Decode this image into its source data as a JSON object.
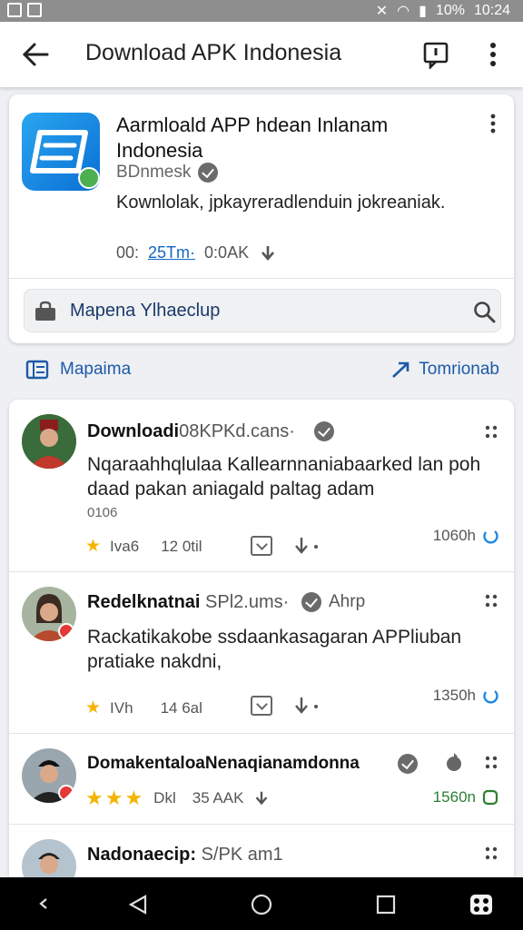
{
  "status": {
    "battery": "10%",
    "time": "10:24"
  },
  "appbar": {
    "title": "Download APK Indonesia"
  },
  "header": {
    "app_title": "Aarmloald APP hdean Inlanam Indonesia",
    "developer": "BDnmesk",
    "description": "Kownlolak, jpkayreradlenduin jokreaniak.",
    "meta_prefix": "00:",
    "meta_link": "25Tm·",
    "meta_size": "0:0AK",
    "search_text": "Mapena Ylhaeclup"
  },
  "section": {
    "left_label": "Mapaima",
    "right_label": "Tomrionab"
  },
  "posts": [
    {
      "name": "Downloadi",
      "handle": "08KPKd.cans·",
      "body": "Nqaraahhqlulaa Kallearnnaniabaarked lan poh daad pakan aniagald paltag adam",
      "small": "0106",
      "rating": "Iva6",
      "count": "12 0til",
      "time": "1060h"
    },
    {
      "name": "Redelknatnai",
      "handle": "SPl2.ums·",
      "extra": "Ahrp",
      "body": "Rackatikakobe ssdaankasagaran APPliuban pratiake nakdni,",
      "rating": "IVh",
      "count": "14 6al",
      "time": "1350h"
    },
    {
      "name": "DomakentaloaNenaqianamdonna",
      "stars": "★★★",
      "rating": "Dkl",
      "count": "35 AAK",
      "time": "1560n"
    },
    {
      "name": "Nadonaecip:",
      "handle": "S/PK am1"
    }
  ],
  "colors": {
    "accent": "#1e5aa8",
    "star": "#f4b400",
    "badge_red": "#e53935"
  }
}
